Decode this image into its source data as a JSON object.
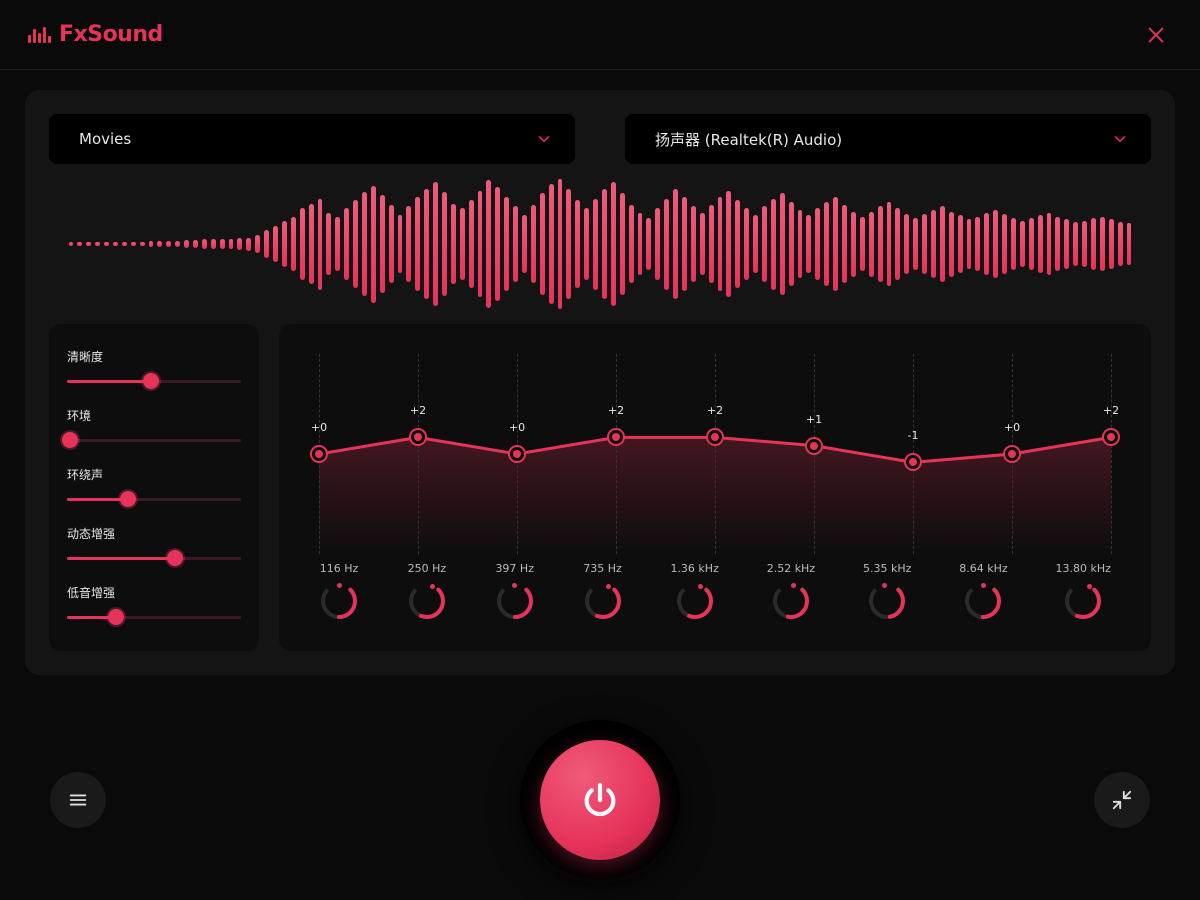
{
  "app": {
    "name": "FxSound"
  },
  "dropdowns": {
    "preset": {
      "selected": "Movies"
    },
    "device": {
      "selected": "扬声器 (Realtek(R) Audio)"
    }
  },
  "visualizer": {
    "bars": [
      3,
      3,
      3,
      3,
      3,
      3,
      3,
      3,
      3,
      4,
      4,
      5,
      5,
      6,
      6,
      7,
      7,
      8,
      8,
      9,
      10,
      14,
      22,
      28,
      35,
      42,
      55,
      62,
      70,
      48,
      42,
      55,
      68,
      80,
      90,
      75,
      60,
      45,
      58,
      72,
      85,
      95,
      80,
      62,
      55,
      68,
      82,
      98,
      88,
      72,
      58,
      45,
      60,
      78,
      92,
      100,
      85,
      68,
      55,
      70,
      85,
      95,
      78,
      60,
      48,
      40,
      55,
      70,
      85,
      72,
      58,
      48,
      60,
      72,
      82,
      68,
      55,
      45,
      58,
      70,
      78,
      65,
      52,
      44,
      55,
      65,
      72,
      60,
      50,
      42,
      50,
      58,
      65,
      55,
      46,
      40,
      46,
      52,
      58,
      50,
      44,
      38,
      42,
      48,
      52,
      46,
      40,
      36,
      40,
      44,
      48,
      42,
      38,
      34,
      36,
      40,
      42,
      38,
      34,
      32
    ]
  },
  "sliders": [
    {
      "label": "清晰度",
      "value": 48
    },
    {
      "label": "环境",
      "value": 2
    },
    {
      "label": "环绕声",
      "value": 35
    },
    {
      "label": "动态增强",
      "value": 62
    },
    {
      "label": "低音增强",
      "value": 28
    }
  ],
  "eq": {
    "bands": [
      {
        "freq": "116 Hz",
        "gain": 0,
        "label": "+0",
        "knob": 50
      },
      {
        "freq": "250 Hz",
        "gain": 2,
        "label": "+2",
        "knob": 58
      },
      {
        "freq": "397 Hz",
        "gain": 0,
        "label": "+0",
        "knob": 50
      },
      {
        "freq": "735 Hz",
        "gain": 2,
        "label": "+2",
        "knob": 58
      },
      {
        "freq": "1.36 kHz",
        "gain": 2,
        "label": "+2",
        "knob": 58
      },
      {
        "freq": "2.52 kHz",
        "gain": 1,
        "label": "+1",
        "knob": 54
      },
      {
        "freq": "5.35 kHz",
        "gain": -1,
        "label": "-1",
        "knob": 46
      },
      {
        "freq": "8.64 kHz",
        "gain": 0,
        "label": "+0",
        "knob": 50
      },
      {
        "freq": "13.80 kHz",
        "gain": 2,
        "label": "+2",
        "knob": 58
      }
    ],
    "range": 12
  },
  "colors": {
    "accent": "#e6335a"
  }
}
